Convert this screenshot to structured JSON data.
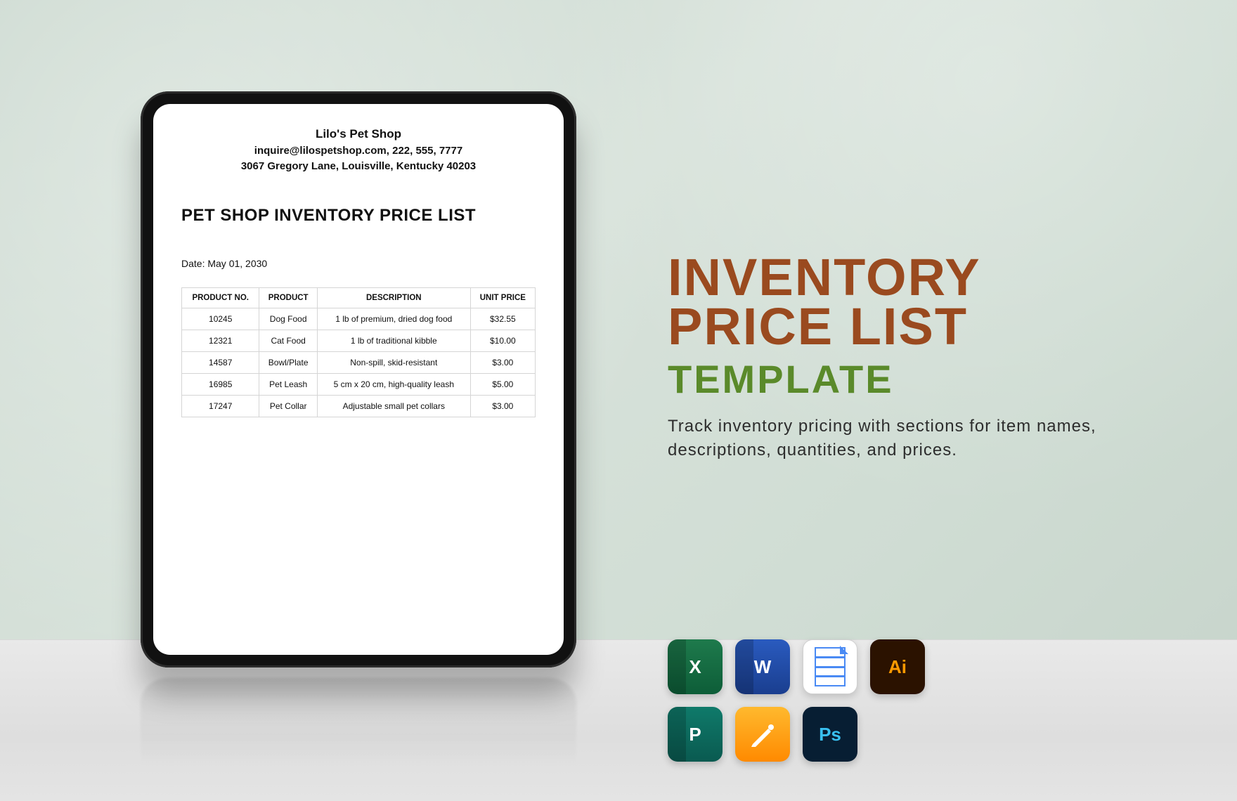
{
  "document": {
    "header": {
      "shop_name": "Lilo's Pet Shop",
      "contact": "inquire@lilospetshop.com, 222, 555, 7777",
      "address": "3067 Gregory Lane, Louisville, Kentucky 40203"
    },
    "title": "PET SHOP INVENTORY PRICE LIST",
    "date_label": "Date: May 01, 2030",
    "columns": {
      "c0": "PRODUCT NO.",
      "c1": "PRODUCT",
      "c2": "DESCRIPTION",
      "c3": "UNIT PRICE"
    },
    "rows": [
      {
        "no": "10245",
        "product": "Dog Food",
        "desc": "1 lb of premium, dried dog food",
        "price": "$32.55"
      },
      {
        "no": "12321",
        "product": "Cat Food",
        "desc": "1 lb of traditional kibble",
        "price": "$10.00"
      },
      {
        "no": "14587",
        "product": "Bowl/Plate",
        "desc": "Non-spill, skid-resistant",
        "price": "$3.00"
      },
      {
        "no": "16985",
        "product": "Pet Leash",
        "desc": "5 cm x 20 cm, high-quality leash",
        "price": "$5.00"
      },
      {
        "no": "17247",
        "product": "Pet Collar",
        "desc": "Adjustable small pet collars",
        "price": "$3.00"
      }
    ]
  },
  "promo": {
    "line1": "INVENTORY",
    "line2": "PRICE LIST",
    "line3": "TEMPLATE",
    "description": "Track inventory pricing with sections for item names, descriptions, quantities, and prices."
  },
  "apps": {
    "excel": "X",
    "word": "W",
    "illustrator": "Ai",
    "publisher": "P",
    "photoshop": "Ps"
  }
}
